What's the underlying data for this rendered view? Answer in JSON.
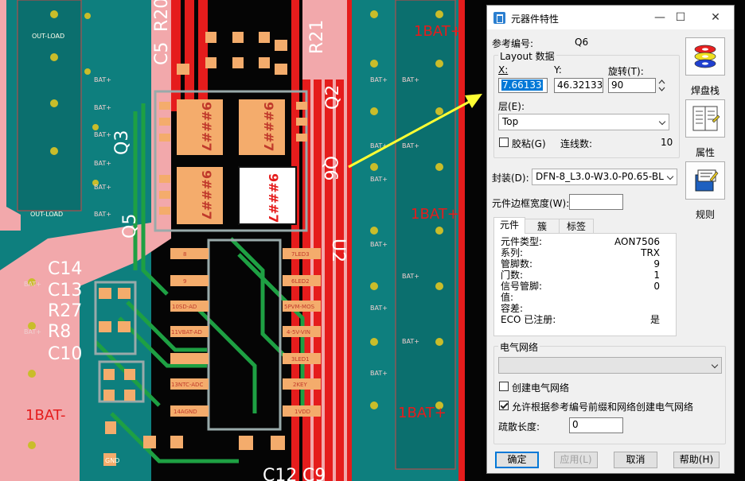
{
  "window": {
    "title": "元器件特性"
  },
  "ref": {
    "label": "参考编号:",
    "value": "Q6"
  },
  "layout": {
    "group_label": "Layout 数据",
    "x_label": "X:",
    "x_value": "7.66133",
    "y_label": "Y:",
    "y_value": "46.32133",
    "rot_label": "旋转(T):",
    "rot_value": "90",
    "layer_label": "层(E):",
    "layer_value": "Top",
    "glue_label": "胶粘(G)",
    "conn_label": "连线数:",
    "conn_value": "10"
  },
  "footprint": {
    "label": "封装(D):",
    "value": "DFN-8_L3.0-W3.0-P0.65-BL"
  },
  "border_width": {
    "label": "元件边框宽度(W):",
    "value": ""
  },
  "side_buttons": {
    "pad_stack": "焊盘栈",
    "properties": "属性",
    "rules": "规则"
  },
  "tabs": [
    "元件",
    "簇",
    "标签"
  ],
  "component": [
    {
      "k": "元件类型:",
      "v": "AON7506"
    },
    {
      "k": "系列:",
      "v": "TRX"
    },
    {
      "k": "管脚数:",
      "v": "9"
    },
    {
      "k": "门数:",
      "v": "1"
    },
    {
      "k": "信号管脚:",
      "v": "0"
    },
    {
      "k": "值:",
      "v": ""
    },
    {
      "k": "容差:",
      "v": ""
    },
    {
      "k": "ECO 已注册:",
      "v": "是"
    }
  ],
  "net": {
    "group_label": "电气网络",
    "combo_value": "",
    "create_label": "创建电气网络",
    "allow_label": "允许根据参考编号前缀和网络创建电气网络",
    "fanout_label": "疏散长度:",
    "fanout_value": "0"
  },
  "buttons": {
    "ok": "确定",
    "apply": "应用(L)",
    "cancel": "取消",
    "help": "帮助(H)"
  },
  "pcb": {
    "silk": [
      "R20",
      "C5",
      "R21",
      "Q2",
      "Q3",
      "Q5",
      "Q6",
      "U2",
      "C14",
      "C13",
      "R27",
      "R8",
      "C10",
      "C12",
      "C9"
    ],
    "bat_plus": "1BAT+",
    "bat_minus": "1BAT-",
    "bat_small": "BAT+",
    "chip_mark": "9###7",
    "nets": [
      "8",
      "9",
      "10SD-AD",
      "11VBAT-AD",
      "13NTC-ADC",
      "14AGND",
      "7LED3",
      "6LED2",
      "5PVM-MOS",
      "4-5V-VIN",
      "3LED1",
      "2KEY",
      "1VDD"
    ],
    "misc": [
      "OUT-LOAD",
      "OUT-LOAD",
      "GND"
    ]
  }
}
